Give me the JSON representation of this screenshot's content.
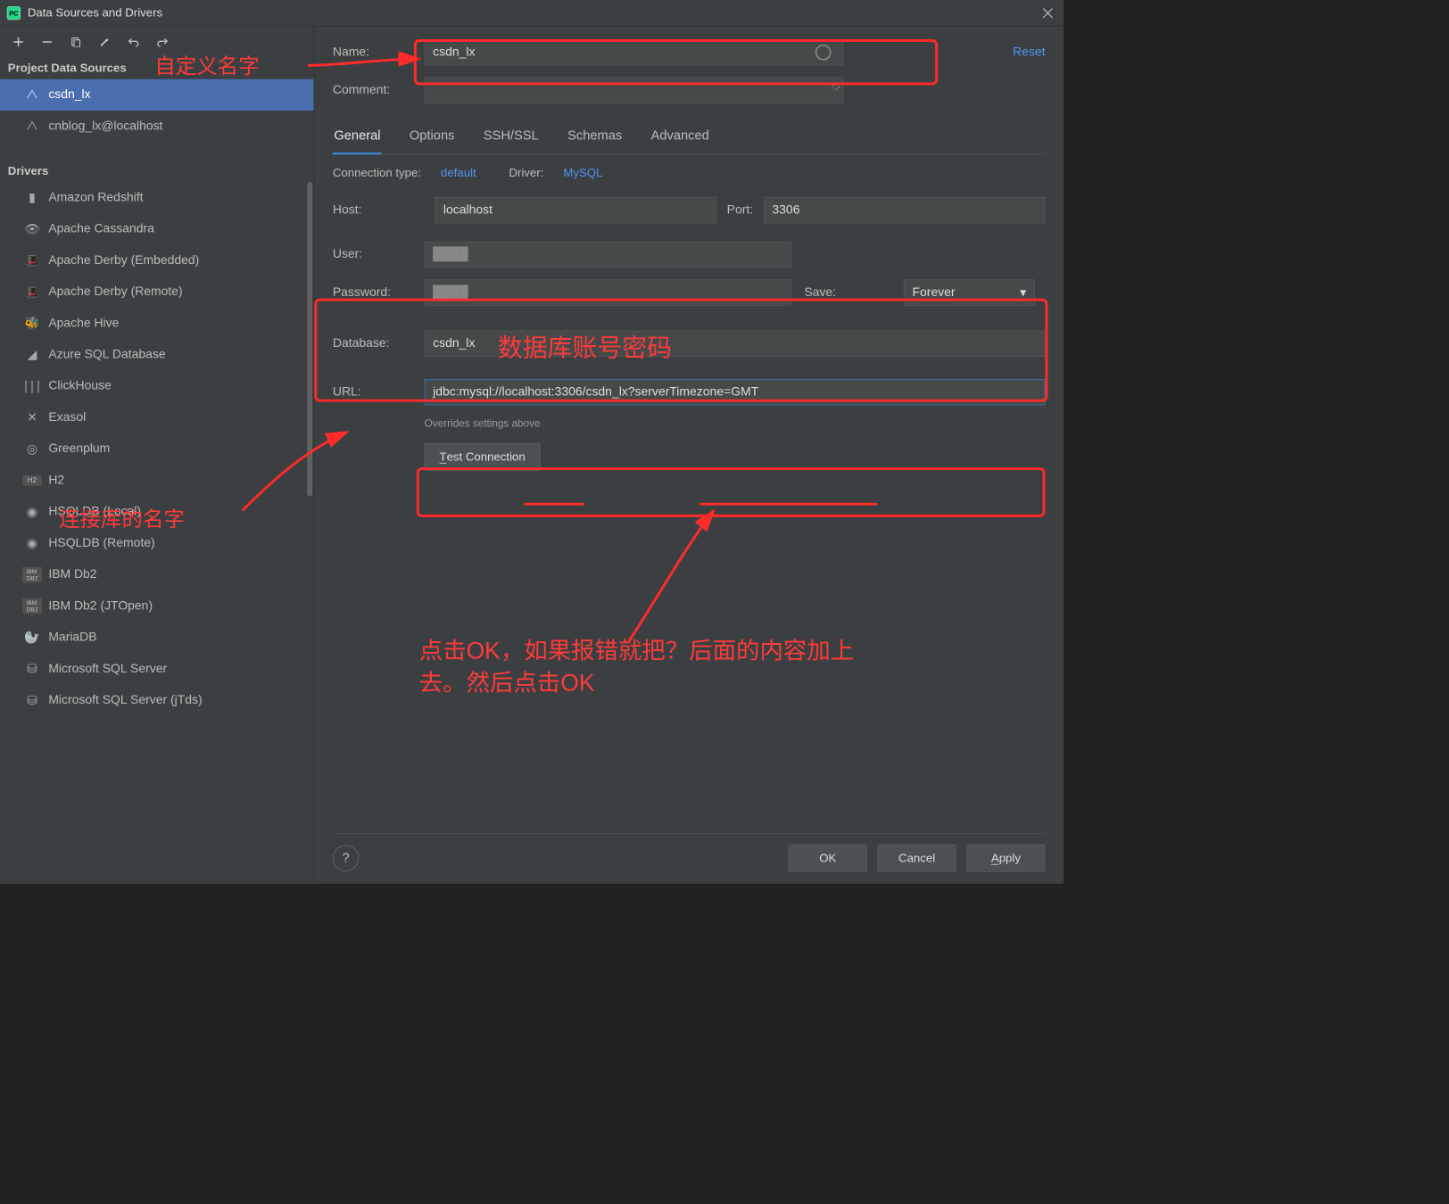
{
  "titlebar": {
    "title": "Data Sources and Drivers"
  },
  "sidebar": {
    "section1": "Project Data Sources",
    "ds": [
      {
        "name": "csdn_lx"
      },
      {
        "name": "cnblog_lx@localhost"
      }
    ],
    "section2": "Drivers",
    "drivers": [
      "Amazon Redshift",
      "Apache Cassandra",
      "Apache Derby (Embedded)",
      "Apache Derby (Remote)",
      "Apache Hive",
      "Azure SQL Database",
      "ClickHouse",
      "Exasol",
      "Greenplum",
      "H2",
      "HSQLDB (Local)",
      "HSQLDB (Remote)",
      "IBM Db2",
      "IBM Db2 (JTOpen)",
      "MariaDB",
      "Microsoft SQL Server",
      "Microsoft SQL Server (jTds)"
    ]
  },
  "form": {
    "name_label": "Name:",
    "name_value": "csdn_lx",
    "reset": "Reset",
    "comment_label": "Comment:",
    "tabs": [
      "General",
      "Options",
      "SSH/SSL",
      "Schemas",
      "Advanced"
    ],
    "conn_type_k": "Connection type:",
    "conn_type_v": "default",
    "driver_k": "Driver:",
    "driver_v": "MySQL",
    "host_label": "Host:",
    "host_value": "localhost",
    "port_label": "Port:",
    "port_value": "3306",
    "user_label": "User:",
    "pwd_label": "Password:",
    "save_label": "Save:",
    "save_value": "Forever",
    "db_label": "Database:",
    "db_value": "csdn_lx",
    "url_label": "URL:",
    "url_value": "jdbc:mysql://localhost:3306/csdn_lx?serverTimezone=GMT",
    "url_hint": "Overrides settings above",
    "test_btn": "Test Connection"
  },
  "buttons": {
    "ok": "OK",
    "cancel": "Cancel",
    "apply": "Apply"
  },
  "annotations": {
    "a1": "自定义名字",
    "a2": "数据库账号密码",
    "a3": "连接库的名字",
    "a4": "点击OK，如果报错就把？后面的内容加上去。然后点击OK"
  }
}
